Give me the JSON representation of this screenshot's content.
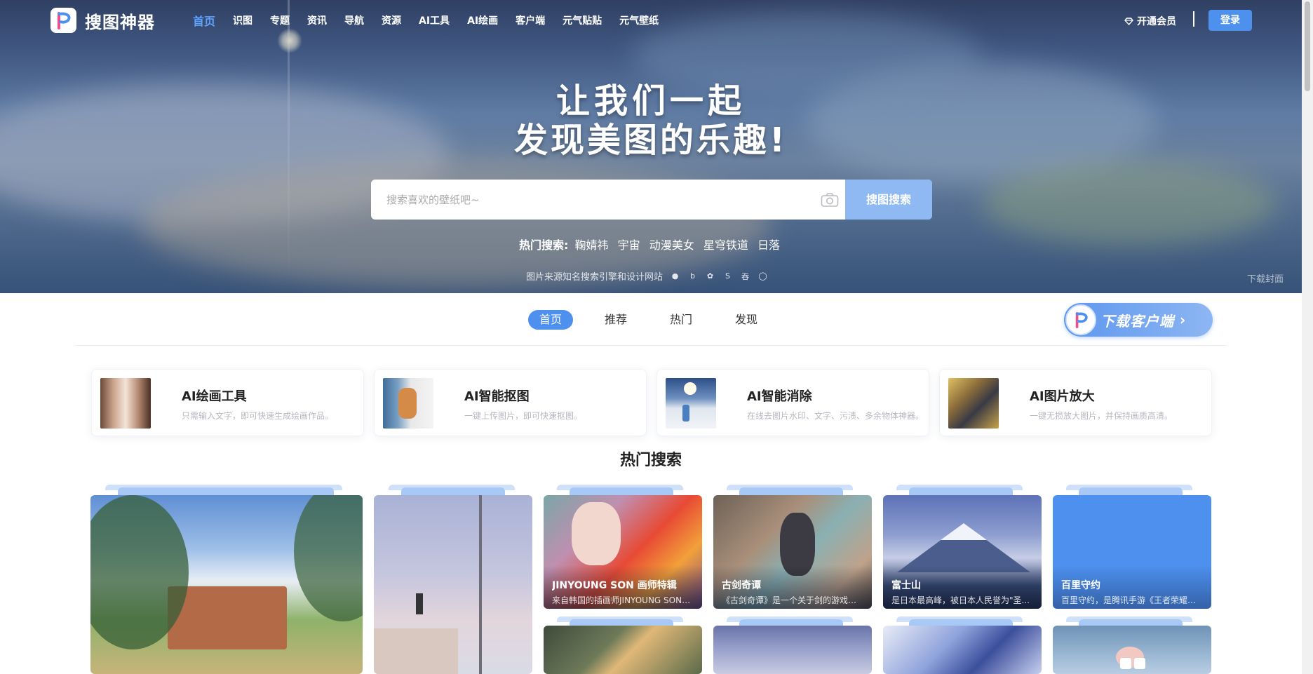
{
  "brand": {
    "name": "搜图神器"
  },
  "nav": {
    "items": [
      "首页",
      "识图",
      "专题",
      "资讯",
      "导航",
      "资源",
      "AI工具",
      "AI绘画",
      "客户端",
      "元气贴贴",
      "元气壁纸"
    ],
    "vip_label": "开通会员",
    "login_label": "登录"
  },
  "hero": {
    "line1": "让我们一起",
    "line2": "发现美图的乐趣!",
    "search_placeholder": "搜索喜欢的壁纸吧~",
    "search_button": "搜图搜索",
    "hot_label": "热门搜索:",
    "hot_keywords": [
      "鞠婧祎",
      "宇宙",
      "动漫美女",
      "星穹铁道",
      "日落"
    ],
    "sources_text": "图片来源知名搜索引擎和设计网站",
    "download_cover": "下载封面"
  },
  "tabs": {
    "items": [
      "首页",
      "推荐",
      "热门",
      "发现"
    ],
    "active": 0
  },
  "download_client": "下载客户端",
  "tools": [
    {
      "title": "AI绘画工具",
      "desc": "只需输入文字，即可快速生成绘画作品。"
    },
    {
      "title": "AI智能抠图",
      "desc": "一键上传图片，即可快速抠图。"
    },
    {
      "title": "AI智能消除",
      "desc": "在线去图片水印、文字、污渍、多余物体神器。"
    },
    {
      "title": "AI图片放大",
      "desc": "一键无损放大图片，并保持画质高清。"
    }
  ],
  "hot_section_title": "热门搜索",
  "gallery": [
    {
      "title": "JINYOUNG SON 画师特辑",
      "desc": "来自韩国的插画师JINYOUNG SON，作品..."
    },
    {
      "title": "古剑奇谭",
      "desc": "《古剑奇谭》是一个关于剑的游戏。..."
    },
    {
      "title": "富士山",
      "desc": "是日本最高峰，被日本人民誉为\"圣..."
    },
    {
      "title": "百里守约",
      "desc": "百里守约，是腾讯手游《王者荣耀》..."
    }
  ],
  "colors": {
    "accent": "#4d90ee",
    "search_button": "#8eb9f2"
  }
}
